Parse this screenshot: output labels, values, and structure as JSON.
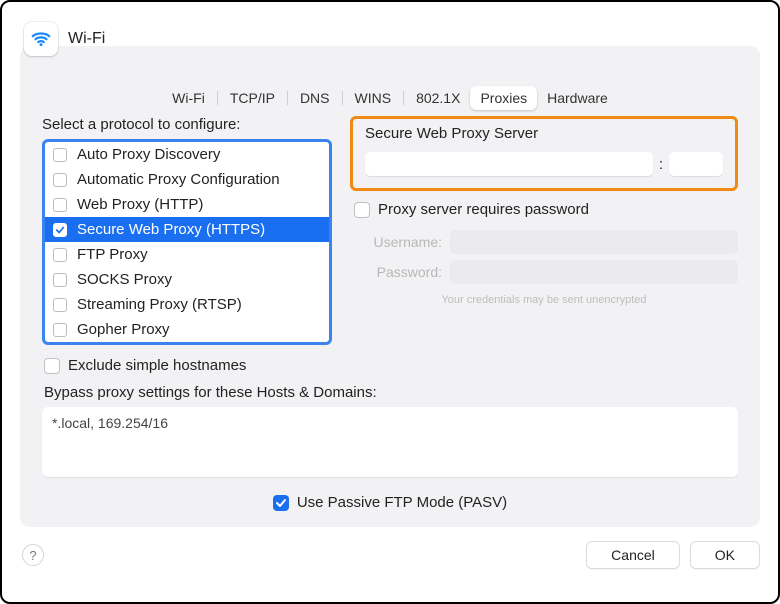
{
  "title": "Wi-Fi",
  "tabs": {
    "items": [
      "Wi-Fi",
      "TCP/IP",
      "DNS",
      "WINS",
      "802.1X",
      "Proxies",
      "Hardware"
    ],
    "active_index": 5
  },
  "left": {
    "select_label": "Select a protocol to configure:",
    "protocols": [
      {
        "label": "Auto Proxy Discovery",
        "checked": false,
        "selected": false
      },
      {
        "label": "Automatic Proxy Configuration",
        "checked": false,
        "selected": false
      },
      {
        "label": "Web Proxy (HTTP)",
        "checked": false,
        "selected": false
      },
      {
        "label": "Secure Web Proxy (HTTPS)",
        "checked": true,
        "selected": true
      },
      {
        "label": "FTP Proxy",
        "checked": false,
        "selected": false
      },
      {
        "label": "SOCKS Proxy",
        "checked": false,
        "selected": false
      },
      {
        "label": "Streaming Proxy (RTSP)",
        "checked": false,
        "selected": false
      },
      {
        "label": "Gopher Proxy",
        "checked": false,
        "selected": false
      }
    ],
    "exclude_label": "Exclude simple hostnames",
    "exclude_checked": false
  },
  "right": {
    "server_title": "Secure Web Proxy Server",
    "host_value": "",
    "port_value": "",
    "colon": ":",
    "requires_password_label": "Proxy server requires password",
    "requires_password_checked": false,
    "username_label": "Username:",
    "password_label": "Password:",
    "username_value": "",
    "password_value": "",
    "credential_note": "Your credentials may be sent unencrypted"
  },
  "bypass": {
    "label": "Bypass proxy settings for these Hosts & Domains:",
    "value": "*.local, 169.254/16"
  },
  "pasv": {
    "label": "Use Passive FTP Mode (PASV)",
    "checked": true
  },
  "footer": {
    "help": "?",
    "cancel": "Cancel",
    "ok": "OK"
  }
}
